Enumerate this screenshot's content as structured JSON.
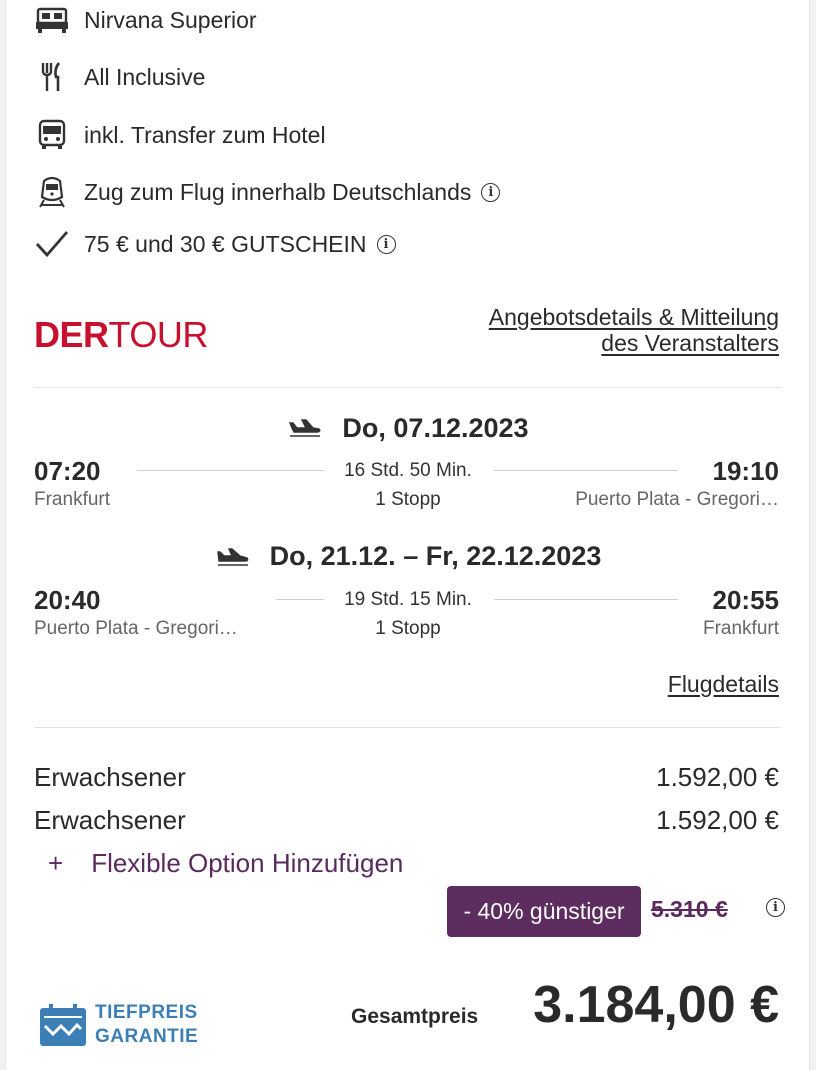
{
  "features": {
    "room": "Nirvana Superior",
    "board": "All Inclusive",
    "transfer": "inkl. Transfer zum Hotel",
    "train": "Zug zum Flug innerhalb Deutschlands",
    "voucher": "75 € und 30 € GUTSCHEIN"
  },
  "operator": {
    "logo_der": "DER",
    "logo_tour": "TOUR",
    "details_link_line1": "Angebotsdetails & Mitteilung",
    "details_link_line2": "des Veranstalters"
  },
  "outbound": {
    "date": "Do, 07.12.2023",
    "dep_time": "07:20",
    "dep_city": "Frankfurt",
    "duration": "16 Std. 50 Min.",
    "stops": "1 Stopp",
    "arr_time": "19:10",
    "arr_city": "Puerto Plata - Gregori…"
  },
  "return": {
    "date": "Do, 21.12. – Fr, 22.12.2023",
    "dep_time": "20:40",
    "dep_city": "Puerto Plata - Gregori…",
    "duration": "19 Std. 15 Min.",
    "stops": "1 Stopp",
    "arr_time": "20:55",
    "arr_city": "Frankfurt"
  },
  "flight_details_link": "Flugdetails",
  "prices": {
    "rows": [
      {
        "label": "Erwachsener",
        "value": "1.592,00 €"
      },
      {
        "label": "Erwachsener",
        "value": "1.592,00 €"
      }
    ],
    "flex_plus": "+",
    "flex_option": "Flexible Option Hinzufügen",
    "discount_badge": "- 40% günstiger",
    "old_price": "5.310 €",
    "total_label": "Gesamtpreis",
    "total_value": "3.184,00 €"
  },
  "guarantee": {
    "line1": "TIEFPREIS",
    "line2": "GARANTIE"
  },
  "colors": {
    "accent_purple": "#5c2d5e",
    "brand_red": "#c8102e",
    "guarantee_blue": "#3b7fb6"
  },
  "info_glyph": "i"
}
